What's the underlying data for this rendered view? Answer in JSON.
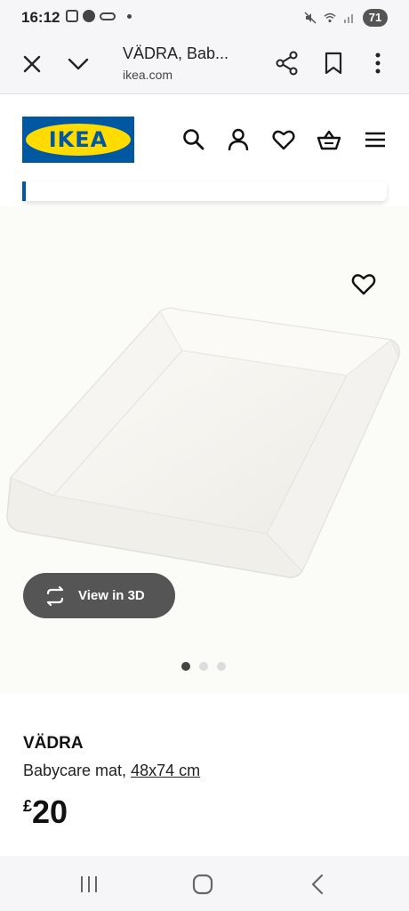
{
  "status_bar": {
    "time": "16:12",
    "battery": "71",
    "icons_left": [
      "screenshot-icon",
      "facebook-icon",
      "voicemail-icon",
      "notification-dot-icon"
    ],
    "icons_right": [
      "mute-icon",
      "wifi-icon",
      "signal-icon",
      "battery-icon"
    ]
  },
  "browser": {
    "title": "VÄDRA, Bab...",
    "url": "ikea.com",
    "icons": [
      "close-icon",
      "chevron-down-icon",
      "share-icon",
      "bookmark-icon",
      "more-vert-icon"
    ]
  },
  "header": {
    "logo_text": "IKEA",
    "icons": [
      "search-icon",
      "account-icon",
      "heart-icon",
      "cart-icon",
      "menu-icon"
    ]
  },
  "colors": {
    "ikea_blue": "#0058a3",
    "ikea_yellow": "#ffdb00",
    "button_dark": "#555555"
  },
  "gallery": {
    "view_3d_label": "View in 3D",
    "slide_count": 3,
    "active_slide": 1
  },
  "product": {
    "name": "VÄDRA",
    "description": "Babycare mat,",
    "dimensions": "48x74 cm",
    "currency": "£",
    "price": "20"
  },
  "system_nav": {
    "icons": [
      "recent-apps-icon",
      "home-icon",
      "back-icon"
    ]
  }
}
